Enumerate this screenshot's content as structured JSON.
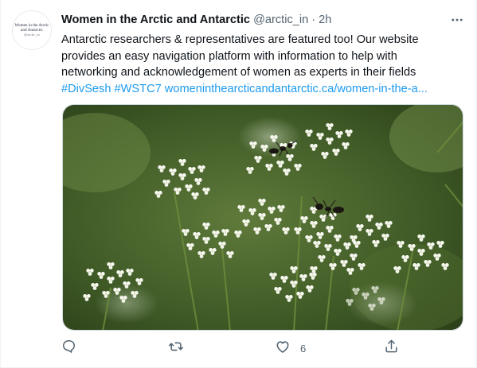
{
  "account": {
    "display_name": "Women in the Arctic and Antarctic",
    "handle": "@arctic_in",
    "separator": "·",
    "time": "2h",
    "avatar_lines": [
      "Women in the Arctic",
      "and Antarctic",
      "@arctic_in"
    ]
  },
  "tweet": {
    "line1": "Antarctic researchers & representatives are featured too! Our website",
    "line2": "provides an easy navigation platform with information to help with",
    "line3": "networking and acknowledgement of women as experts in their fields",
    "hashtag1": "#DivSesh",
    "hashtag2": "#WSTC7",
    "url": "womeninthearcticandantarctic.ca/women-in-the-a..."
  },
  "media": {
    "description_icon": "photo-white-flowers-with-ants"
  },
  "actions": {
    "reply_icon": "reply-icon",
    "retweet_icon": "retweet-icon",
    "like_icon": "like-icon",
    "like_count": "6",
    "share_icon": "share-icon"
  },
  "colors": {
    "link": "#1d9bf0",
    "secondary_text": "#536471",
    "primary_text": "#0f1419"
  }
}
